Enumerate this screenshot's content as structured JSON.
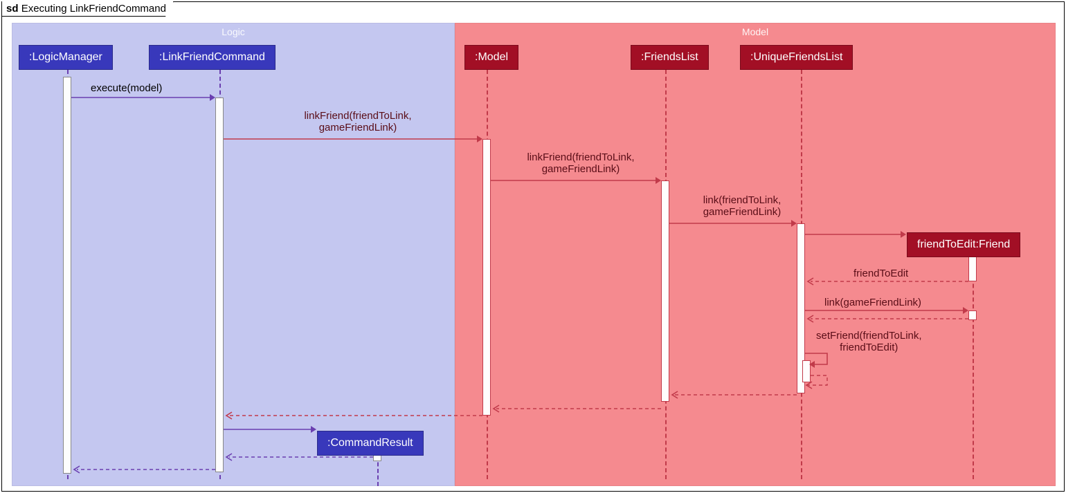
{
  "frame": {
    "prefix": "sd",
    "title": "Executing LinkFriendCommand"
  },
  "regions": {
    "logic": "Logic",
    "model": "Model"
  },
  "lifelines": {
    "logicManager": ":LogicManager",
    "linkFriendCommand": ":LinkFriendCommand",
    "commandResult": ":CommandResult",
    "model": ":Model",
    "friendsList": ":FriendsList",
    "uniqueFriendsList": ":UniqueFriendsList",
    "friendToEdit": "friendToEdit:Friend"
  },
  "messages": {
    "execute": "execute(model)",
    "linkFriend1a": "linkFriend(friendToLink,",
    "linkFriend1b": "gameFriendLink)",
    "linkFriend2a": "linkFriend(friendToLink,",
    "linkFriend2b": "gameFriendLink)",
    "link1a": "link(friendToLink,",
    "link1b": "gameFriendLink)",
    "retFriendToEdit": "friendToEdit",
    "linkGfl": "link(gameFriendLink)",
    "setFriendA": "setFriend(friendToLink,",
    "setFriendB": "friendToEdit)"
  },
  "colors": {
    "blue": "#3838bb",
    "darkred": "#a20f25"
  }
}
